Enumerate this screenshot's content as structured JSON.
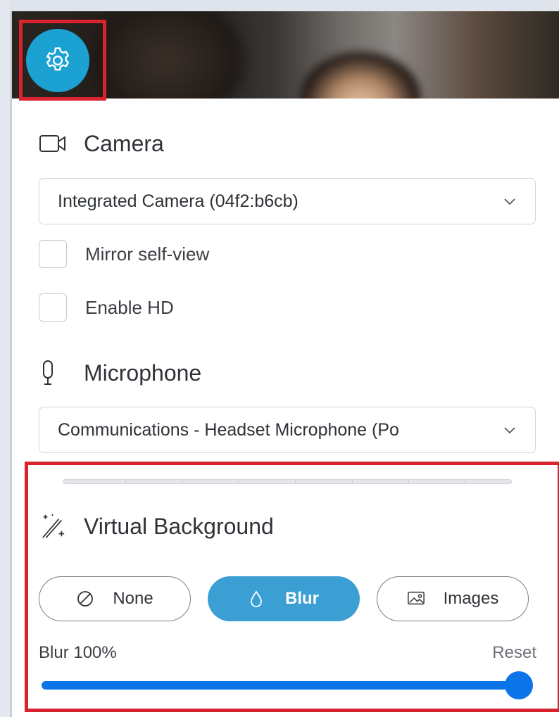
{
  "header": {
    "settings_icon": "gear-icon",
    "accent_color": "#1ba2d3"
  },
  "camera": {
    "title": "Camera",
    "icon": "video-camera-icon",
    "selected_device": "Integrated Camera (04f2:b6cb)",
    "options": [
      {
        "label": "Mirror self-view",
        "checked": false
      },
      {
        "label": "Enable HD",
        "checked": false
      }
    ]
  },
  "microphone": {
    "title": "Microphone",
    "icon": "microphone-icon",
    "selected_device": "Communications - Headset Microphone (Po"
  },
  "virtual_background": {
    "title": "Virtual Background",
    "icon": "magic-wand-icon",
    "options": [
      {
        "label": "None",
        "icon": "none-icon",
        "selected": false
      },
      {
        "label": "Blur",
        "icon": "droplet-icon",
        "selected": true
      },
      {
        "label": "Images",
        "icon": "image-icon",
        "selected": false
      }
    ],
    "blur_label": "Blur 100%",
    "blur_value": 100,
    "reset_label": "Reset",
    "slider_color": "#0a74e8",
    "active_color": "#3b9fd3",
    "highlight_color": "#d9232e"
  }
}
